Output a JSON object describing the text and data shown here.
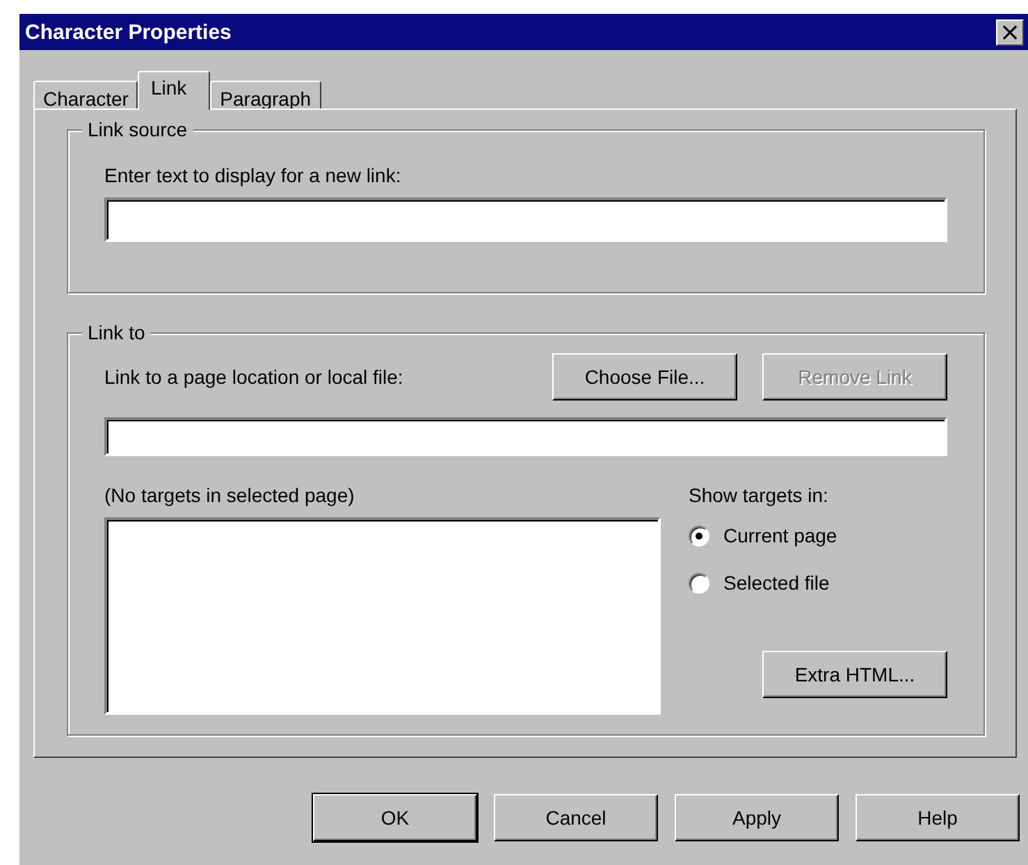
{
  "window": {
    "title": "Character Properties",
    "close": "×"
  },
  "tabs": [
    {
      "label": "Character",
      "selected": false
    },
    {
      "label": "Link",
      "selected": true
    },
    {
      "label": "Paragraph",
      "selected": false
    }
  ],
  "link_source": {
    "legend": "Link source",
    "label": "Enter text to display for a new link:"
  },
  "link_to": {
    "legend": "Link to",
    "label": "Link to a page location or local file:",
    "buttons": [
      {
        "label": "Choose File...",
        "disabled": false
      },
      {
        "label": "Remove Link",
        "disabled": true
      }
    ],
    "targets_label": "(No targets in selected page)",
    "show_label": "Show targets in:",
    "radios": [
      {
        "label": "Current page",
        "selected": true
      },
      {
        "label": "Selected file",
        "selected": false
      }
    ],
    "extra_button": {
      "label": "Extra HTML...",
      "disabled": false
    }
  },
  "buttons": [
    {
      "label": "OK",
      "default": true
    },
    {
      "label": "Cancel",
      "default": false
    },
    {
      "label": "Apply",
      "default": false
    },
    {
      "label": "Help",
      "default": false
    }
  ]
}
